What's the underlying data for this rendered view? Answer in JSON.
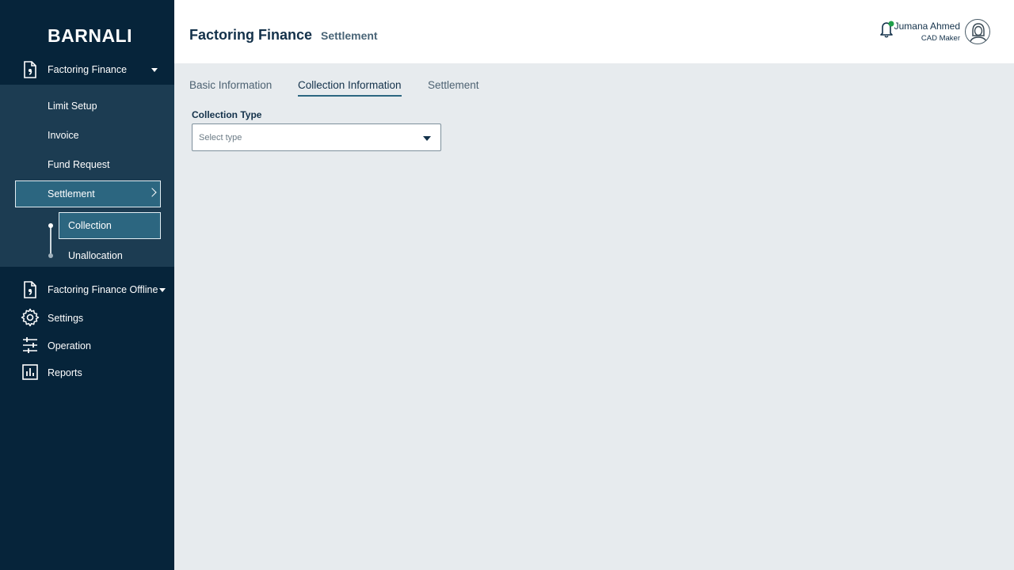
{
  "sidebar": {
    "brand": "BARNALI",
    "top_item": {
      "label": "Factoring Finance",
      "icon": "document-icon"
    },
    "submenu": {
      "limit_setup": "Limit Setup",
      "invoice": "Invoice",
      "fund_request": "Fund Request",
      "settlement": "Settlement",
      "collection": "Collection",
      "unallocation": "Unallocation"
    },
    "items": [
      {
        "label": "Factoring Finance Offline",
        "icon": "document-icon"
      },
      {
        "label": "Settings",
        "icon": "gear-icon"
      },
      {
        "label": "Operation",
        "icon": "sliders-icon"
      },
      {
        "label": "Reports",
        "icon": "bar-chart-icon"
      }
    ]
  },
  "header": {
    "title": "Factoring Finance",
    "subtitle": "Settlement",
    "user_name": "Jumana Ahmed",
    "user_role": "CAD Maker",
    "notification_dot_color": "#21a04a"
  },
  "tabs": [
    {
      "label": "Basic Information"
    },
    {
      "label": "Collection Information",
      "active": true
    },
    {
      "label": "Settlement"
    }
  ],
  "form": {
    "collection_type_label": "Collection Type",
    "collection_type_placeholder": "Select type"
  },
  "colors": {
    "sidebar_bg": "#06243a",
    "submenu_bg": "#1c3c52",
    "active_bg": "#2c6680",
    "content_bg": "#e7ebee"
  }
}
